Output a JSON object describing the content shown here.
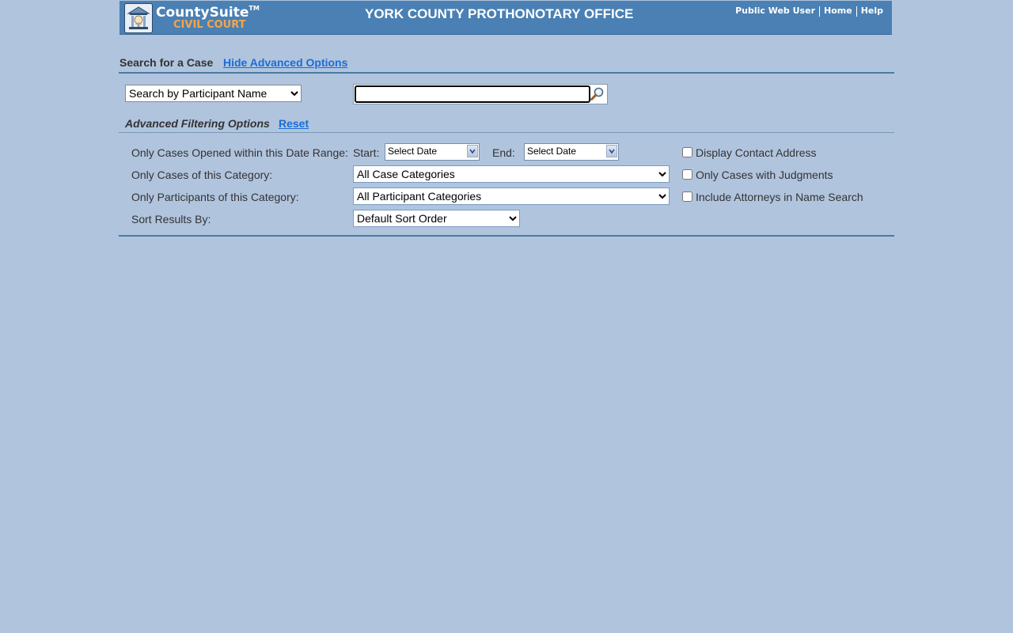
{
  "header": {
    "logo_title": "CountySuite",
    "logo_tm": "TM",
    "logo_subtitle": "CIVIL COURT",
    "office_title": "YORK COUNTY PROTHONOTARY OFFICE",
    "nav": [
      "Public Web User",
      "Home",
      "Help"
    ]
  },
  "search": {
    "heading": "Search for a Case",
    "toggle_link": "Hide Advanced Options",
    "type_selected": "Search by Participant Name",
    "query_value": ""
  },
  "advanced": {
    "title": "Advanced Filtering Options",
    "reset_label": "Reset",
    "date_range_label": "Only Cases Opened within this Date Range:",
    "start_label": "Start:",
    "start_value": "Select Date",
    "end_label": "End:",
    "end_value": "Select Date",
    "case_category_label": "Only Cases of this Category:",
    "case_category_value": "All Case Categories",
    "participant_category_label": "Only Participants of this Category:",
    "participant_category_value": "All Participant Categories",
    "sort_label": "Sort Results By:",
    "sort_value": "Default Sort Order",
    "checkboxes": [
      {
        "label": "Display Contact Address",
        "checked": false
      },
      {
        "label": "Only Cases with Judgments",
        "checked": false
      },
      {
        "label": "Include Attorneys in Name Search",
        "checked": false
      }
    ]
  },
  "colors": {
    "background": "#b0c4de",
    "banner": "#4a80b4",
    "link": "#1a6dd6",
    "logo_subtitle": "#f5a54a"
  }
}
